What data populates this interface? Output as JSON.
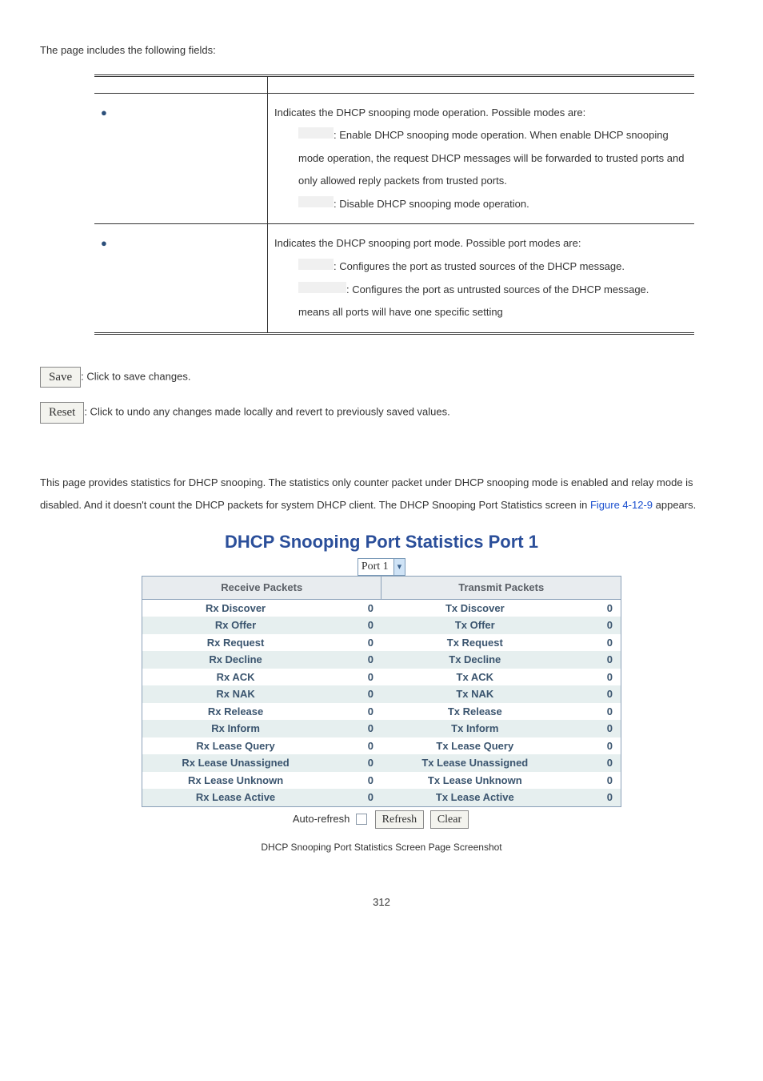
{
  "intro": "The page includes the following fields:",
  "fields_table": {
    "headers": [
      "",
      ""
    ],
    "rows": [
      {
        "desc_intro": "Indicates the DHCP snooping mode operation. Possible modes are:",
        "bullets": [
          ": Enable DHCP snooping mode operation. When enable DHCP snooping mode operation, the request DHCP messages will be forwarded to trusted ports and only allowed reply packets from trusted ports.",
          ": Disable DHCP snooping mode operation."
        ]
      },
      {
        "desc_intro": "Indicates the DHCP snooping port mode. Possible port modes are:",
        "bullets": [
          ": Configures the port as trusted sources of the DHCP message.",
          ": Configures the port as untrusted sources of the DHCP message."
        ],
        "trail": "means all ports will have one specific setting"
      }
    ]
  },
  "save_btn": "Save",
  "save_text": ": Click to save changes.",
  "reset_btn": "Reset",
  "reset_text": ": Click to undo any changes made locally and revert to previously saved values.",
  "section_p1": "This page provides statistics for DHCP snooping. The statistics only counter packet under DHCP snooping mode is enabled and relay mode is disabled. And it doesn't count the DHCP packets for system DHCP client. The DHCP Snooping Port Statistics screen in ",
  "section_link": "Figure 4-12-9",
  "section_p2": " appears.",
  "stats_heading": "DHCP Snooping Port Statistics  Port 1",
  "port_dropdown": "Port 1",
  "stats_headers": {
    "rx": "Receive Packets",
    "tx": "Transmit Packets"
  },
  "stats_rows": [
    {
      "rx_label": "Rx Discover",
      "rx_val": "0",
      "tx_label": "Tx Discover",
      "tx_val": "0"
    },
    {
      "rx_label": "Rx Offer",
      "rx_val": "0",
      "tx_label": "Tx Offer",
      "tx_val": "0"
    },
    {
      "rx_label": "Rx Request",
      "rx_val": "0",
      "tx_label": "Tx Request",
      "tx_val": "0"
    },
    {
      "rx_label": "Rx Decline",
      "rx_val": "0",
      "tx_label": "Tx Decline",
      "tx_val": "0"
    },
    {
      "rx_label": "Rx ACK",
      "rx_val": "0",
      "tx_label": "Tx ACK",
      "tx_val": "0"
    },
    {
      "rx_label": "Rx NAK",
      "rx_val": "0",
      "tx_label": "Tx NAK",
      "tx_val": "0"
    },
    {
      "rx_label": "Rx Release",
      "rx_val": "0",
      "tx_label": "Tx Release",
      "tx_val": "0"
    },
    {
      "rx_label": "Rx Inform",
      "rx_val": "0",
      "tx_label": "Tx Inform",
      "tx_val": "0"
    },
    {
      "rx_label": "Rx Lease Query",
      "rx_val": "0",
      "tx_label": "Tx Lease Query",
      "tx_val": "0"
    },
    {
      "rx_label": "Rx Lease Unassigned",
      "rx_val": "0",
      "tx_label": "Tx Lease Unassigned",
      "tx_val": "0"
    },
    {
      "rx_label": "Rx Lease Unknown",
      "rx_val": "0",
      "tx_label": "Tx Lease Unknown",
      "tx_val": "0"
    },
    {
      "rx_label": "Rx Lease Active",
      "rx_val": "0",
      "tx_label": "Tx Lease Active",
      "tx_val": "0"
    }
  ],
  "auto_refresh_label": "Auto-refresh",
  "refresh_btn": "Refresh",
  "clear_btn": "Clear",
  "caption": "DHCP Snooping Port Statistics Screen Page Screenshot",
  "page_number": "312"
}
